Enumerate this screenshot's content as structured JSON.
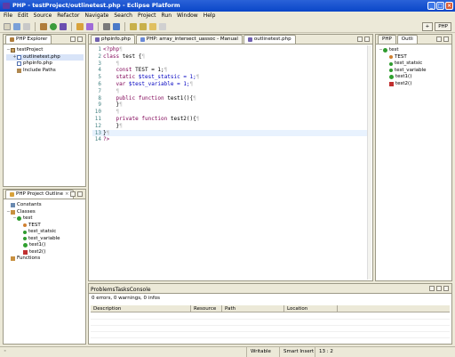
{
  "window": {
    "title": "PHP - testProject/outlinetest.php - Eclipse Platform"
  },
  "menu": [
    "File",
    "Edit",
    "Source",
    "Refactor",
    "Navigate",
    "Search",
    "Project",
    "Run",
    "Window",
    "Help"
  ],
  "perspectives": {
    "current": "PHP"
  },
  "explorer": {
    "tab": "PHP Explorer",
    "items": [
      {
        "label": "testProject",
        "icon": "project-icon",
        "level": 0,
        "toggle": "−"
      },
      {
        "label": "outlinetest.php",
        "icon": "php-file-icon",
        "level": 1,
        "toggle": "+",
        "selected": true
      },
      {
        "label": "phpinfo.php",
        "icon": "php-file-icon",
        "level": 1,
        "toggle": ""
      },
      {
        "label": "Include Paths",
        "icon": "library-icon",
        "level": 1,
        "toggle": ""
      }
    ]
  },
  "php_outline": {
    "tab": "PHP Project Outline",
    "items": [
      {
        "label": "Constants",
        "icon": "constants-icon",
        "level": 0,
        "toggle": ""
      },
      {
        "label": "Classes",
        "icon": "classes-icon",
        "level": 0,
        "toggle": "−"
      },
      {
        "label": "test",
        "icon": "class-icon",
        "level": 1,
        "toggle": "−"
      },
      {
        "label": "TEST",
        "icon": "constant-icon",
        "level": 2,
        "toggle": ""
      },
      {
        "label": "test_statsic",
        "icon": "static-field-icon",
        "level": 2,
        "toggle": ""
      },
      {
        "label": "test_variable",
        "icon": "field-icon",
        "level": 2,
        "toggle": ""
      },
      {
        "label": "test1()",
        "icon": "public-method-icon",
        "level": 2,
        "toggle": ""
      },
      {
        "label": "test2()",
        "icon": "private-method-icon",
        "level": 2,
        "toggle": ""
      },
      {
        "label": "Functions",
        "icon": "functions-icon",
        "level": 0,
        "toggle": ""
      }
    ]
  },
  "editor": {
    "tabs": [
      {
        "label": "phpinfo.php",
        "active": false
      },
      {
        "label": "PHP: array_intersect_uassoc - Manual",
        "active": false
      },
      {
        "label": "outlinetest.php",
        "active": true
      }
    ],
    "lines": [
      {
        "n": "1",
        "parts": [
          {
            "t": "<?php",
            "c": "tag"
          },
          {
            "t": "¶",
            "c": "gr"
          }
        ]
      },
      {
        "n": "2",
        "parts": [
          {
            "t": "class",
            "c": "kw"
          },
          {
            "t": " test {",
            "c": ""
          },
          {
            "t": "¶",
            "c": "gr"
          }
        ]
      },
      {
        "n": "3",
        "parts": [
          {
            "t": "    ",
            "c": ""
          },
          {
            "t": "¶",
            "c": "gr"
          }
        ]
      },
      {
        "n": "4",
        "parts": [
          {
            "t": "    ",
            "c": ""
          },
          {
            "t": "const",
            "c": "kw"
          },
          {
            "t": " TEST = 1;",
            "c": ""
          },
          {
            "t": "¶",
            "c": "gr"
          }
        ]
      },
      {
        "n": "5",
        "parts": [
          {
            "t": "    ",
            "c": ""
          },
          {
            "t": "static",
            "c": "kw"
          },
          {
            "t": " $test_statsic = 1;",
            "c": "var"
          },
          {
            "t": "¶",
            "c": "gr"
          }
        ]
      },
      {
        "n": "6",
        "parts": [
          {
            "t": "    ",
            "c": ""
          },
          {
            "t": "var",
            "c": "kw"
          },
          {
            "t": " $test_variable = 1;",
            "c": "var"
          },
          {
            "t": "¶",
            "c": "gr"
          }
        ]
      },
      {
        "n": "7",
        "parts": [
          {
            "t": "    ",
            "c": ""
          },
          {
            "t": "¶",
            "c": "gr"
          }
        ]
      },
      {
        "n": "8",
        "parts": [
          {
            "t": "    ",
            "c": ""
          },
          {
            "t": "public function",
            "c": "kw"
          },
          {
            "t": " test1(){",
            "c": ""
          },
          {
            "t": "¶",
            "c": "gr"
          }
        ]
      },
      {
        "n": "9",
        "parts": [
          {
            "t": "    }",
            "c": ""
          },
          {
            "t": "¶",
            "c": "gr"
          }
        ]
      },
      {
        "n": "10",
        "parts": [
          {
            "t": "    ",
            "c": ""
          },
          {
            "t": "¶",
            "c": "gr"
          }
        ]
      },
      {
        "n": "11",
        "parts": [
          {
            "t": "    ",
            "c": ""
          },
          {
            "t": "private function",
            "c": "kw"
          },
          {
            "t": " test2(){",
            "c": ""
          },
          {
            "t": "¶",
            "c": "gr"
          }
        ]
      },
      {
        "n": "12",
        "parts": [
          {
            "t": "    }",
            "c": ""
          },
          {
            "t": "¶",
            "c": "gr"
          }
        ]
      },
      {
        "n": "13",
        "parts": [
          {
            "t": "}",
            "c": ""
          },
          {
            "t": "¶",
            "c": "gr"
          }
        ],
        "current": true
      },
      {
        "n": "14",
        "parts": [
          {
            "t": "?>",
            "c": "tag"
          }
        ]
      }
    ]
  },
  "outline": {
    "tabs": [
      "PHP",
      "Outli"
    ],
    "items": [
      {
        "label": "test",
        "icon": "class-icon",
        "level": 0,
        "toggle": "−"
      },
      {
        "label": "TEST",
        "icon": "constant-icon",
        "level": 1,
        "toggle": ""
      },
      {
        "label": "test_statsic",
        "icon": "static-field-icon",
        "level": 1,
        "toggle": ""
      },
      {
        "label": "test_variable",
        "icon": "field-icon",
        "level": 1,
        "toggle": ""
      },
      {
        "label": "test1()",
        "icon": "public-method-icon",
        "level": 1,
        "toggle": ""
      },
      {
        "label": "test2()",
        "icon": "private-method-icon",
        "level": 1,
        "toggle": ""
      }
    ]
  },
  "problems": {
    "tabs": [
      "Problems",
      "Tasks",
      "Console"
    ],
    "summary": "0 errors, 0 warnings, 0 infos",
    "columns": [
      "Description",
      "Resource",
      "Path",
      "Location"
    ]
  },
  "status": {
    "mode": "Writable",
    "insert": "Smart Insert",
    "position": "13 : 2"
  },
  "colors": {
    "title_bar": "#0a46c8",
    "keyword": "#7f0055",
    "variable": "#0000c0",
    "line_number": "#3f7f7f"
  }
}
